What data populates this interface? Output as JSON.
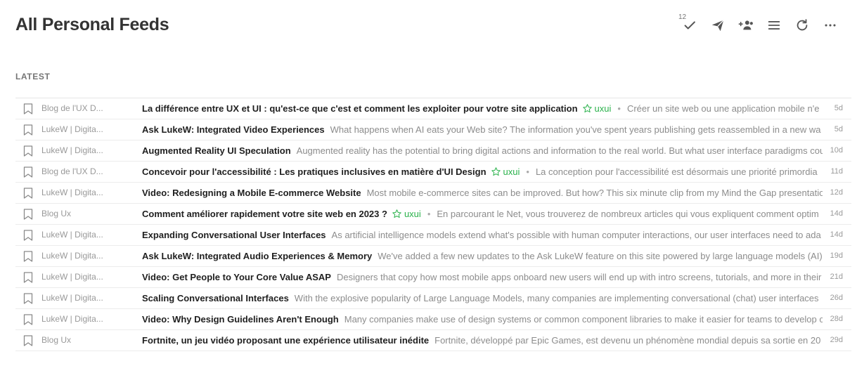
{
  "header": {
    "title": "All Personal Feeds"
  },
  "toolbar": {
    "mark_read_count": "12",
    "icons": [
      "check-icon",
      "send-icon",
      "people-add-icon",
      "list-view-icon",
      "refresh-icon",
      "more-icon"
    ]
  },
  "section": {
    "label": "LATEST"
  },
  "colors": {
    "accent_green": "#2bb24c",
    "title_text": "#1f1f1f",
    "muted_text": "#8c8c8c"
  },
  "articles": [
    {
      "source": "Blog de l'UX D...",
      "title": "La différence entre UX et UI : qu'est-ce que c'est et comment les exploiter pour votre site application",
      "tag": "uxui",
      "summary": "Créer un site web ou une application mobile n'e",
      "age": "5d"
    },
    {
      "source": "LukeW | Digita...",
      "title": "Ask LukeW: Integrated Video Experiences",
      "tag": "",
      "summary": "What happens when AI eats your Web site? The information you've spent years publishing gets reassembled in a new wa",
      "age": "5d"
    },
    {
      "source": "LukeW | Digita...",
      "title": "Augmented Reality UI Speculation",
      "tag": "",
      "summary": "Augmented reality has the potential to bring digital actions and information to the real world. But what user interface paradigms cou",
      "age": "10d"
    },
    {
      "source": "Blog de l'UX D...",
      "title": "Concevoir pour l'accessibilité : Les pratiques inclusives en matière d'UI Design",
      "tag": "uxui",
      "summary": "La conception pour l'accessibilité est désormais une priorité primordia",
      "age": "11d"
    },
    {
      "source": "LukeW | Digita...",
      "title": "Video: Redesigning a Mobile E-commerce Website",
      "tag": "",
      "summary": "Most mobile e-commerce sites can be improved. But how? This six minute clip from my Mind the Gap presentatio",
      "age": "12d"
    },
    {
      "source": "Blog Ux",
      "title": "Comment améliorer rapidement votre site web en 2023 ?",
      "tag": "uxui",
      "summary": "En parcourant le Net, vous trouverez de nombreux articles qui vous expliquent comment optim",
      "age": "14d"
    },
    {
      "source": "LukeW | Digita...",
      "title": "Expanding Conversational User Interfaces",
      "tag": "",
      "summary": "As artificial intelligence models extend what's possible with human computer interactions, our user interfaces need to ada",
      "age": "14d"
    },
    {
      "source": "LukeW | Digita...",
      "title": "Ask LukeW: Integrated Audio Experiences & Memory",
      "tag": "",
      "summary": "We've added a few new updates to the Ask LukeW feature on this site powered by large language models (AI)",
      "age": "19d"
    },
    {
      "source": "LukeW | Digita...",
      "title": "Video: Get People to Your Core Value ASAP",
      "tag": "",
      "summary": "Designers that copy how most mobile apps onboard new users will end up with intro screens, tutorials, and more in their",
      "age": "21d"
    },
    {
      "source": "LukeW | Digita...",
      "title": "Scaling Conversational Interfaces",
      "tag": "",
      "summary": "With the explosive popularity of Large Language Models, many companies are implementing conversational (chat) user interfaces",
      "age": "26d"
    },
    {
      "source": "LukeW | Digita...",
      "title": "Video: Why Design Guidelines Aren't Enough",
      "tag": "",
      "summary": "Many companies make use of design systems or common component libraries to make it easier for teams to develop c",
      "age": "28d"
    },
    {
      "source": "Blog Ux",
      "title": "Fortnite, un jeu vidéo proposant une expérience utilisateur inédite",
      "tag": "",
      "summary": "Fortnite, développé par Epic Games, est devenu un phénomène mondial depuis sa sortie en 20",
      "age": "29d"
    }
  ]
}
